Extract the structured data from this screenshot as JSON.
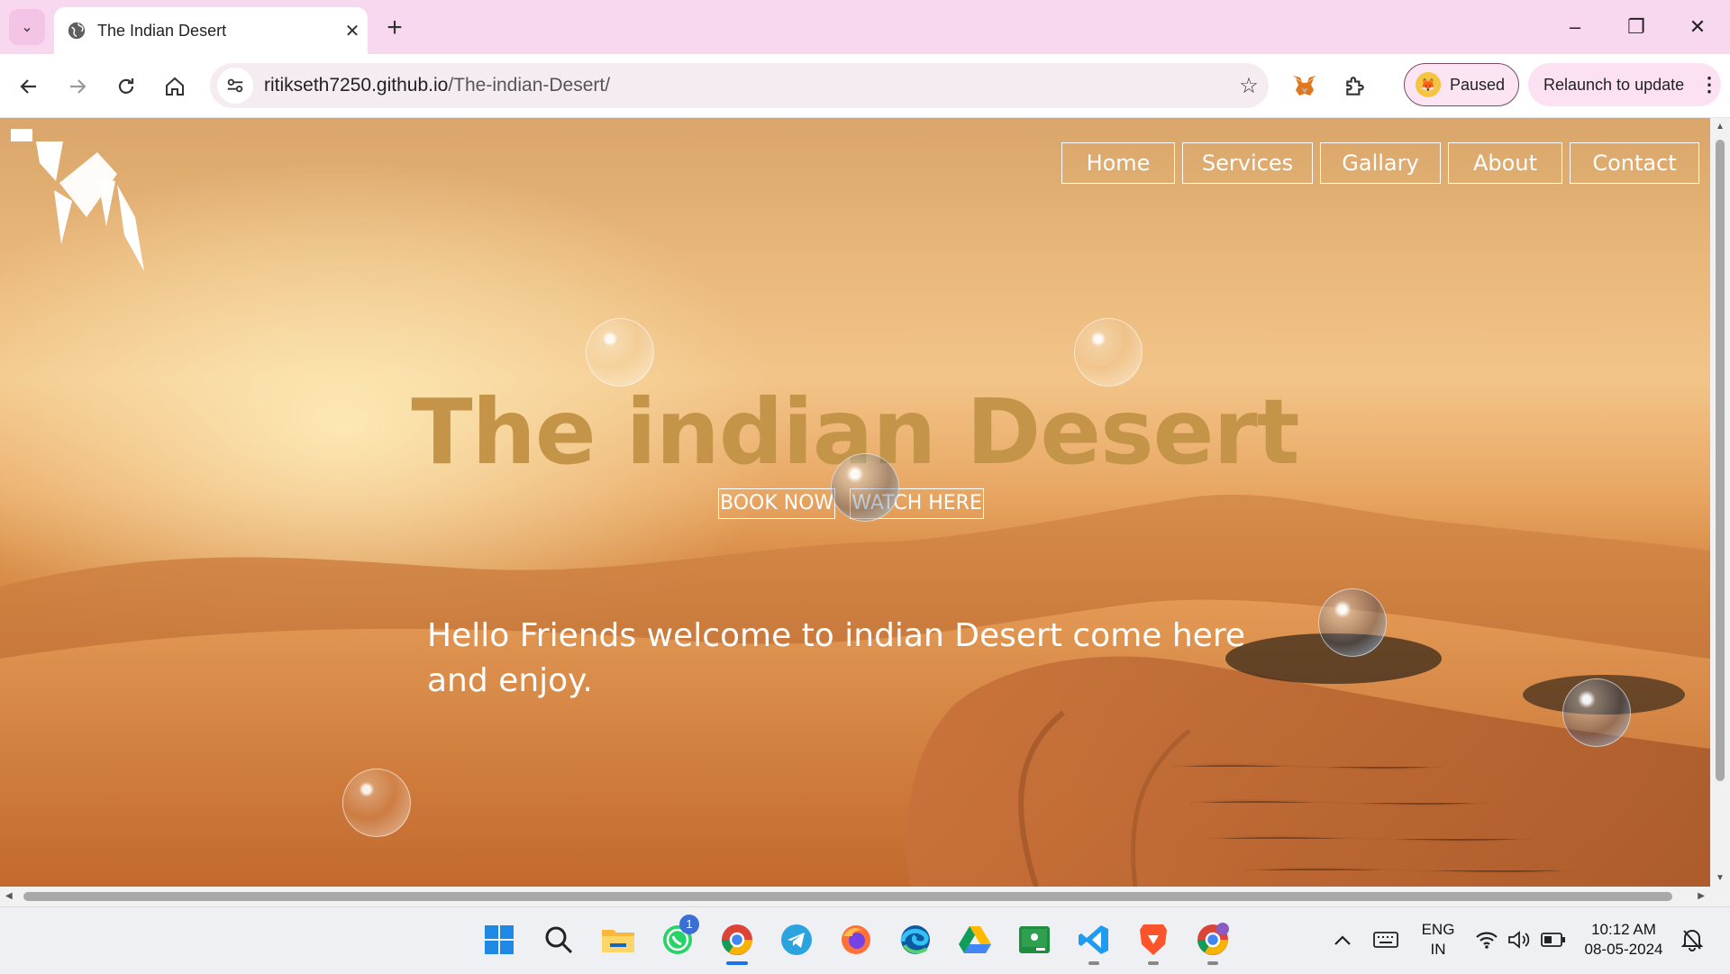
{
  "browser": {
    "tab_title": "The Indian Desert",
    "url_host": "ritikseth7250.github.io",
    "url_path": "/The-indian-Desert/",
    "profile_status": "Paused",
    "relaunch_label": "Relaunch to update"
  },
  "site": {
    "nav": [
      "Home",
      "Services",
      "Gallary",
      "About",
      "Contact"
    ],
    "hero_title": "The indian Desert",
    "buttons": [
      "BOOK NOW",
      "WATCH HERE"
    ],
    "welcome_text": "Hello Friends welcome to indian Desert come here and enjoy."
  },
  "taskbar": {
    "whatsapp_badge": "1",
    "language_line1": "ENG",
    "language_line2": "IN",
    "time": "10:12 AM",
    "date": "08-05-2024"
  },
  "icons": [
    "tab-search-icon",
    "globe-icon",
    "close-icon",
    "new-tab-icon",
    "minimize-icon",
    "restore-icon",
    "window-close-icon",
    "back-icon",
    "forward-icon",
    "reload-icon",
    "home-icon",
    "site-info-icon",
    "bookmark-star-icon",
    "metamask-fox-icon",
    "extensions-puzzle-icon",
    "kebab-menu-icon",
    "windows-start-icon",
    "search-icon",
    "file-explorer-icon",
    "whatsapp-icon",
    "chrome-icon",
    "telegram-icon",
    "firefox-icon",
    "edge-icon",
    "google-drive-icon",
    "google-classroom-icon",
    "vscode-icon",
    "brave-icon",
    "chrome-profile-icon",
    "chevron-up-icon",
    "keyboard-icon",
    "wifi-icon",
    "volume-icon",
    "battery-icon",
    "notification-icon"
  ]
}
